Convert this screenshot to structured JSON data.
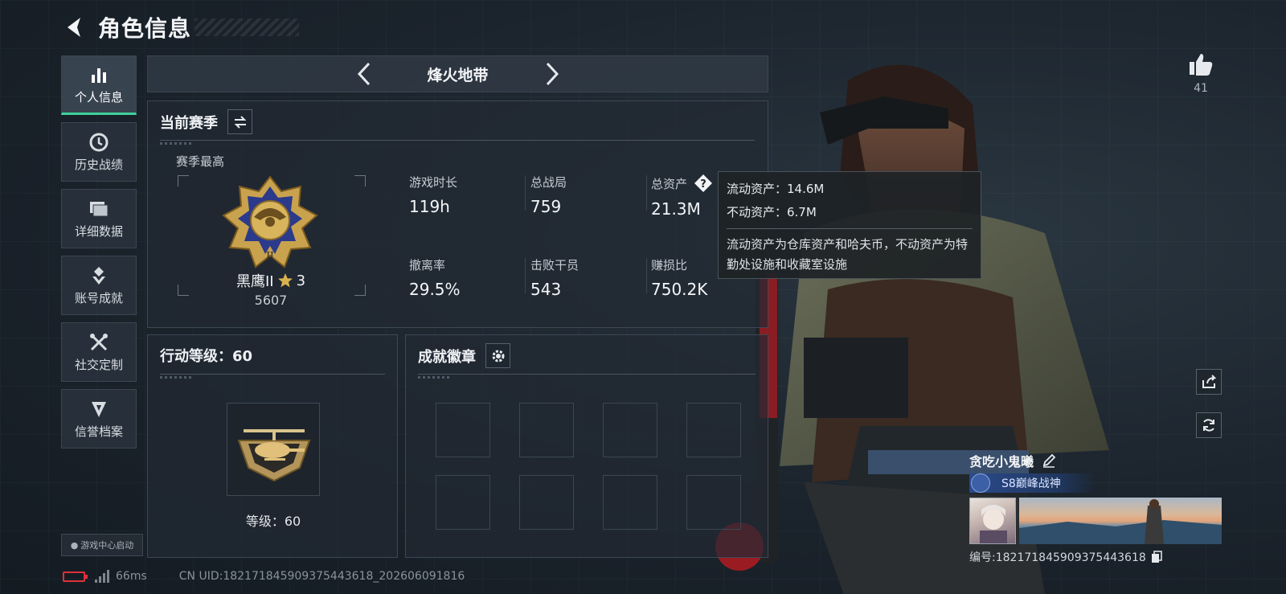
{
  "header": {
    "title": "角色信息"
  },
  "sidebar": {
    "items": [
      {
        "label": "个人信息",
        "icon": "bar-chart-icon",
        "active": true
      },
      {
        "label": "历史战绩",
        "icon": "clock-icon",
        "active": false
      },
      {
        "label": "详细数据",
        "icon": "folder-icon",
        "active": false
      },
      {
        "label": "账号成就",
        "icon": "medal-icon",
        "active": false
      },
      {
        "label": "社交定制",
        "icon": "tools-icon",
        "active": false
      },
      {
        "label": "信誉档案",
        "icon": "shield-icon",
        "active": false
      }
    ],
    "game_center_label": "游戏中心启动"
  },
  "mode": {
    "name": "烽火地带"
  },
  "season": {
    "title": "当前赛季",
    "best_label": "赛季最高",
    "rank_name": "黑鹰II",
    "rank_stars": "3",
    "rank_score": "5607",
    "stats": [
      {
        "label": "游戏时长",
        "value": "119h"
      },
      {
        "label": "总战局",
        "value": "759"
      },
      {
        "label": "总资产",
        "value": "21.3M"
      },
      {
        "label": "撤离率",
        "value": "29.5%"
      },
      {
        "label": "击败干员",
        "value": "543"
      },
      {
        "label": "赚损比",
        "value": "750.2K"
      }
    ]
  },
  "tooltip": {
    "liquid": "流动资产：14.6M",
    "fixed": "不动资产：6.7M",
    "desc": "流动资产为仓库资产和哈夫币，不动资产为特勤处设施和收藏室设施"
  },
  "action_level": {
    "title": "行动等级：60",
    "level_text": "等级：60"
  },
  "achievements": {
    "title": "成就徽章"
  },
  "likes": {
    "count": "41"
  },
  "player": {
    "name": "贪吃小鬼曦",
    "title": "S8巅峰战神",
    "id_text": "编号:18217184590937544361​8"
  },
  "footer": {
    "ping": "66ms",
    "uid": "CN UID:182171845909375443618_202606091816"
  },
  "colors": {
    "accent": "#3ed19c",
    "panel_border": "#3c4855",
    "battery_low": "#e0303a"
  }
}
